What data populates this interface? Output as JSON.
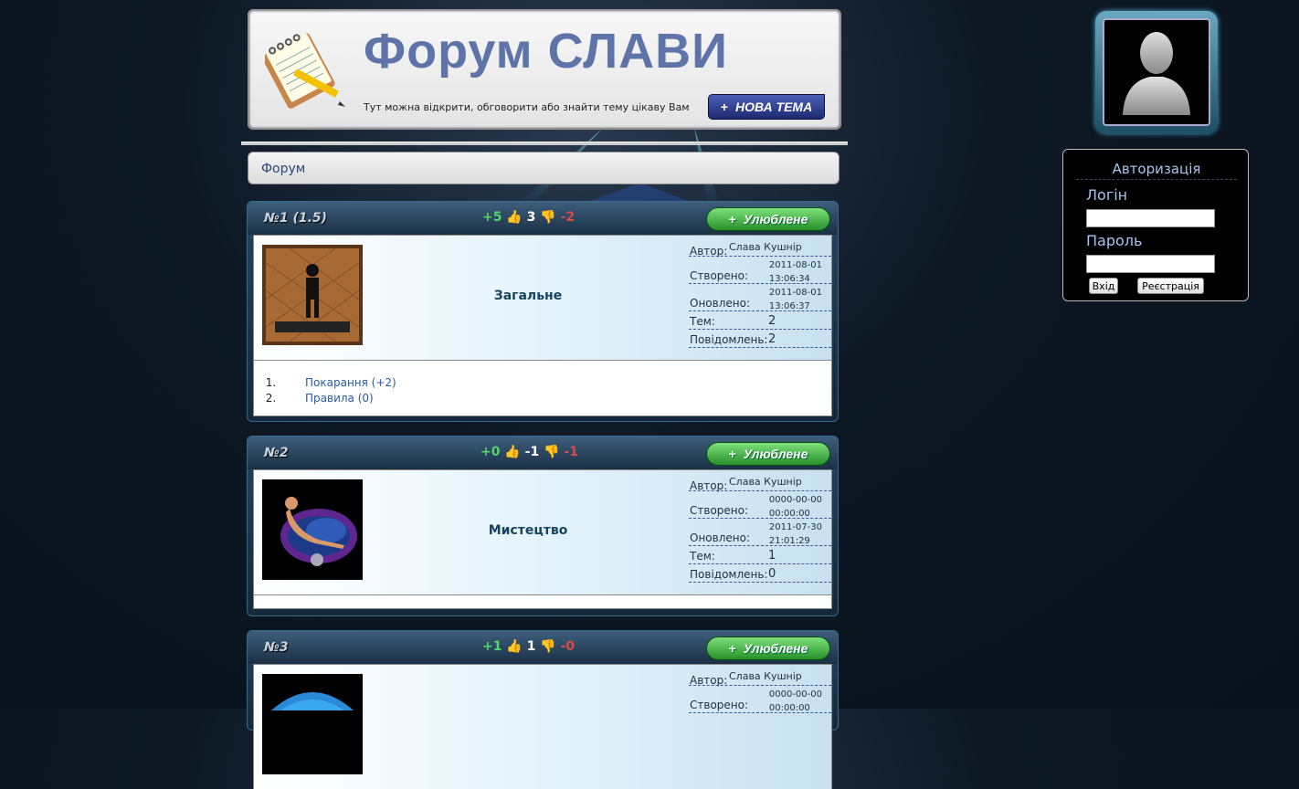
{
  "header": {
    "title": "Форум СЛАВИ",
    "subtitle": "Тут можна відкрити, обговорити або знайти тему цікаву Вам",
    "new_topic_label": "НОВА ТЕМА",
    "icon": "notepad-pencil-icon"
  },
  "breadcrumb": {
    "label": "Форум"
  },
  "meta_labels": {
    "author": "Автор:",
    "created": "Створено:",
    "updated": "Оновлено:",
    "topics": "Тем:",
    "messages": "Повідомлень:"
  },
  "favorite_label": "Улюблене",
  "forums": [
    {
      "num": "№1",
      "rating": "(1.5)",
      "plus": "+5",
      "score": "3",
      "minus": "-2",
      "name": "Загальне",
      "author": "Слава Кушнір",
      "created_date": "2011-08-01",
      "created_time": "13:06:34",
      "updated_date": "2011-08-01",
      "updated_time": "13:06:37",
      "topics": "2",
      "messages": "2",
      "image": "poster-brown-figure",
      "subforums": [
        {
          "label": "Покарання (+2)"
        },
        {
          "label": "Правила (0)"
        }
      ]
    },
    {
      "num": "№2",
      "rating": "",
      "plus": "+0",
      "score": "-1",
      "minus": "-1",
      "name": "Мистецтво",
      "author": "Слава Кушнір",
      "created_date": "0000-00-00",
      "created_time": "00:00:00",
      "updated_date": "2011-07-30",
      "updated_time": "21:01:29",
      "topics": "1",
      "messages": "0",
      "image": "art-figure-purple"
    },
    {
      "num": "№3",
      "rating": "",
      "plus": "+1",
      "score": "1",
      "minus": "-0",
      "author": "Слава Кушнір",
      "created_date": "0000-00-00",
      "created_time": "00:00:00",
      "image": "umbrella-blue"
    }
  ],
  "auth": {
    "title": "Авторизація",
    "login_label": "Логін",
    "password_label": "Пароль",
    "login_button": "Вхід",
    "register_button": "Реєстрація"
  },
  "colors": {
    "title": "#5e73a8",
    "plus": "#55d26a",
    "minus": "#d84a4a",
    "favorite": "#27902b",
    "link": "#2a5aa8"
  }
}
